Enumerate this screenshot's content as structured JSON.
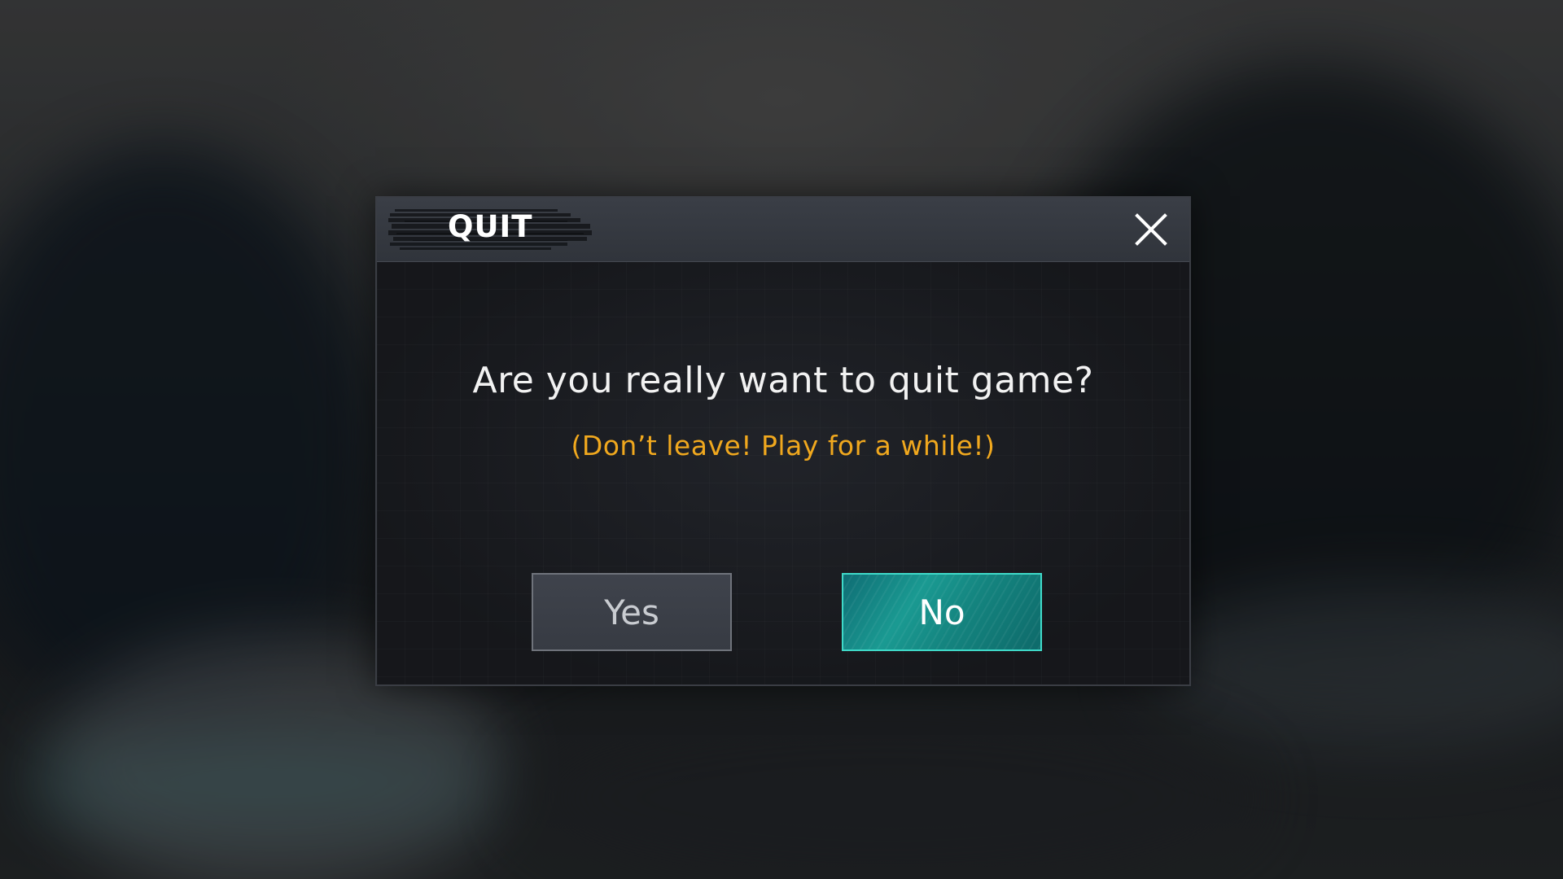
{
  "dialog": {
    "title": "QUIT",
    "close_icon": "close-icon",
    "question": "Are you really want to quit game?",
    "subtitle": "(Don’t leave! Play for a while!)",
    "yes_label": "Yes",
    "no_label": "No"
  },
  "colors": {
    "subtitle": "#f0a81e",
    "primary_button": "#14847f",
    "primary_button_border": "#3fd9c8",
    "secondary_button": "#3b3f47"
  }
}
